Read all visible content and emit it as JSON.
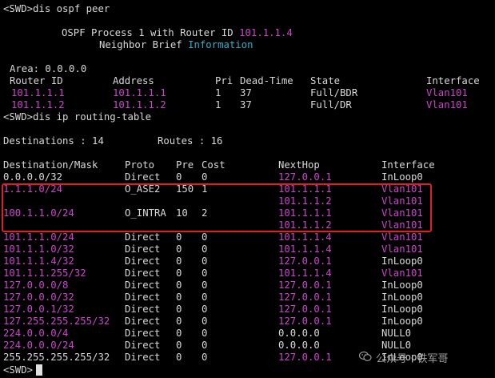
{
  "commands": {
    "dis_ospf_peer": "<SWD>dis ospf peer",
    "dis_ip_routing": "<SWD>dis ip routing-table",
    "prompt": "<SWD>"
  },
  "ospf": {
    "process_line_prefix": "OSPF Process 1 with Router ID ",
    "router_id": "101.1.1.4",
    "neighbor_line_prefix": "Neighbor Brief ",
    "neighbor_line_suffix": "Information",
    "area": "Area: 0.0.0.0",
    "headers": {
      "router_id": "Router ID",
      "address": "Address",
      "pri": "Pri",
      "dead_time": "Dead-Time",
      "state": "State",
      "interface": "Interface"
    },
    "peers": [
      {
        "router_id": "101.1.1.1",
        "address": "101.1.1.1",
        "pri": "1",
        "dead_time": "37",
        "state": "Full/BDR",
        "interface": "Vlan101"
      },
      {
        "router_id": "101.1.1.2",
        "address": "101.1.1.2",
        "pri": "1",
        "dead_time": "37",
        "state": "Full/DR",
        "interface": "Vlan101"
      }
    ]
  },
  "routing": {
    "destinations_label": "Destinations : 14",
    "routes_label": "Routes : 16",
    "headers": {
      "dest": "Destination/Mask",
      "proto": "Proto",
      "pre": "Pre",
      "cost": "Cost",
      "nexthop": "NextHop",
      "interface": "Interface"
    },
    "rows": [
      {
        "dest": "0.0.0.0/32",
        "proto": "Direct",
        "pre": "0",
        "cost": "0",
        "nexthop": "127.0.0.1",
        "iface": "InLoop0",
        "dm": false,
        "nm": true,
        "im": false
      },
      {
        "dest": "1.1.1.0/24",
        "proto": "O_ASE2",
        "pre": "150",
        "cost": "1",
        "nexthop": "101.1.1.1",
        "iface": "Vlan101",
        "dm": true,
        "nm": true,
        "im": true
      },
      {
        "dest": "",
        "proto": "",
        "pre": "",
        "cost": "",
        "nexthop": "101.1.1.2",
        "iface": "Vlan101",
        "dm": true,
        "nm": true,
        "im": true
      },
      {
        "dest": "100.1.1.0/24",
        "proto": "O_INTRA",
        "pre": "10",
        "cost": "2",
        "nexthop": "101.1.1.1",
        "iface": "Vlan101",
        "dm": true,
        "nm": true,
        "im": true
      },
      {
        "dest": "",
        "proto": "",
        "pre": "",
        "cost": "",
        "nexthop": "101.1.1.2",
        "iface": "Vlan101",
        "dm": true,
        "nm": true,
        "im": true
      },
      {
        "dest": "101.1.1.0/24",
        "proto": "Direct",
        "pre": "0",
        "cost": "0",
        "nexthop": "101.1.1.4",
        "iface": "Vlan101",
        "dm": true,
        "nm": true,
        "im": true
      },
      {
        "dest": "101.1.1.0/32",
        "proto": "Direct",
        "pre": "0",
        "cost": "0",
        "nexthop": "101.1.1.4",
        "iface": "Vlan101",
        "dm": true,
        "nm": true,
        "im": true
      },
      {
        "dest": "101.1.1.4/32",
        "proto": "Direct",
        "pre": "0",
        "cost": "0",
        "nexthop": "127.0.0.1",
        "iface": "InLoop0",
        "dm": true,
        "nm": true,
        "im": false
      },
      {
        "dest": "101.1.1.255/32",
        "proto": "Direct",
        "pre": "0",
        "cost": "0",
        "nexthop": "101.1.1.4",
        "iface": "Vlan101",
        "dm": true,
        "nm": true,
        "im": true
      },
      {
        "dest": "127.0.0.0/8",
        "proto": "Direct",
        "pre": "0",
        "cost": "0",
        "nexthop": "127.0.0.1",
        "iface": "InLoop0",
        "dm": true,
        "nm": true,
        "im": false
      },
      {
        "dest": "127.0.0.0/32",
        "proto": "Direct",
        "pre": "0",
        "cost": "0",
        "nexthop": "127.0.0.1",
        "iface": "InLoop0",
        "dm": true,
        "nm": true,
        "im": false
      },
      {
        "dest": "127.0.0.1/32",
        "proto": "Direct",
        "pre": "0",
        "cost": "0",
        "nexthop": "127.0.0.1",
        "iface": "InLoop0",
        "dm": true,
        "nm": true,
        "im": false
      },
      {
        "dest": "127.255.255.255/32",
        "proto": "Direct",
        "pre": "0",
        "cost": "0",
        "nexthop": "127.0.0.1",
        "iface": "InLoop0",
        "dm": true,
        "nm": true,
        "im": false
      },
      {
        "dest": "224.0.0.0/4",
        "proto": "Direct",
        "pre": "0",
        "cost": "0",
        "nexthop": "0.0.0.0",
        "iface": "NULL0",
        "dm": true,
        "nm": false,
        "im": false
      },
      {
        "dest": "224.0.0.0/24",
        "proto": "Direct",
        "pre": "0",
        "cost": "0",
        "nexthop": "0.0.0.0",
        "iface": "NULL0",
        "dm": true,
        "nm": false,
        "im": false
      },
      {
        "dest": "255.255.255.255/32",
        "proto": "Direct",
        "pre": "0",
        "cost": "0",
        "nexthop": "127.0.0.1",
        "iface": "InLoop0",
        "dm": false,
        "nm": true,
        "im": false
      }
    ]
  },
  "watermark": {
    "icon": "wechat-icon",
    "text": "公众号 · 铁军哥"
  },
  "colors": {
    "text": "#d8d8d8",
    "magenta": "#cc44cc",
    "cyan": "#2fb0c8",
    "highlight_box": "#e02020",
    "background": "#000000"
  }
}
